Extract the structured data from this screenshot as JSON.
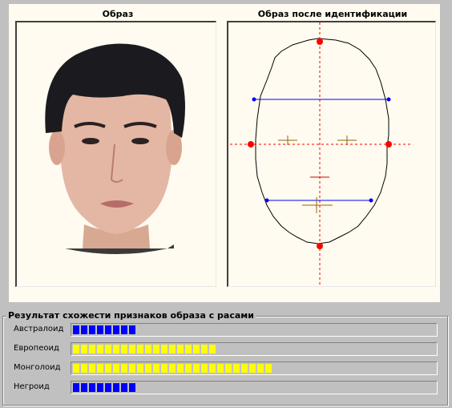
{
  "panels": {
    "left_title": "Образ",
    "right_title": "Образ после идентификации"
  },
  "results": {
    "group_title": "Результат схожести признаков образа с расами",
    "races": [
      {
        "label": "Австралоид",
        "level": 0.175,
        "color": "#0000ff"
      },
      {
        "label": "Европеоид",
        "level": 0.395,
        "color": "#ffff00"
      },
      {
        "label": "Монголоид",
        "level": 0.55,
        "color": "#ffff00"
      },
      {
        "label": "Негроид",
        "level": 0.175,
        "color": "#0000ff"
      }
    ]
  },
  "colors": {
    "background": "#c0c0c0",
    "panel": "#fffbf0",
    "axis_dash": "#ff0000",
    "width_line": "#0000ff",
    "landmark": "#ff0000",
    "feature_mark": "#996600"
  }
}
